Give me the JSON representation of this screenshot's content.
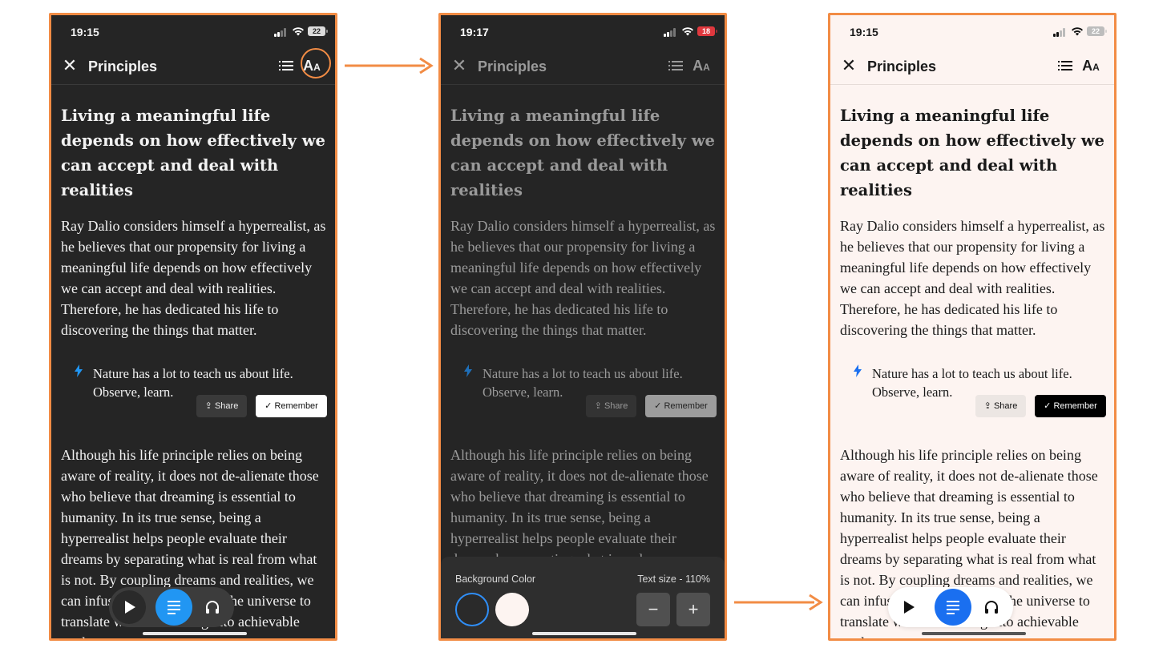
{
  "colors": {
    "outline": "#f28c45",
    "dark_bg": "#252525",
    "light_bg": "#fdf4f1",
    "accent_dark_mode": "#2196f3",
    "accent_light_mode": "#1a6ff0"
  },
  "screens": [
    {
      "time": "19:15",
      "battery": "22",
      "title": "Principles",
      "close_icon": "close-icon",
      "toc_icon": "list-icon",
      "font_icon_label": "AA",
      "heading": "Living a meaningful life depends on how effectively we can accept and deal with realities",
      "paragraph1": "Ray Dalio considers himself a hyperrealist, as he believes that our propensity for living a meaningful life depends on how effectively we can accept and deal with realities. Therefore, he has dedicated his life to discovering the things that matter.",
      "insight": "Nature has a lot to teach us about life. Observe, learn.",
      "share_label": "Share",
      "remember_label": "Remember",
      "paragraph2": "Although his life principle relies on being aware of reality, it does not de-alienate those who believe that dreaming is essential to humanity. In its true sense, being a hyperrealist helps people evaluate their dreams by separating what is real from what is not. By coupling dreams and realities, we can infuse the many laws of the universe to translate wishful thinking into achievable goals."
    },
    {
      "time": "19:17",
      "battery": "18",
      "title": "Principles",
      "heading": "Living a meaningful life depends on how effectively we can accept and deal with realities",
      "paragraph1": "Ray Dalio considers himself a hyperrealist, as he believes that our propensity for living a meaningful life depends on how effectively we can accept and deal with realities. Therefore, he has dedicated his life to discovering the things that matter.",
      "insight": "Nature has a lot to teach us about life. Observe, learn.",
      "share_label": "Share",
      "remember_label": "Remember",
      "paragraph2": "Although his life principle relies on being aware of reality, it does not de-alienate those who believe that dreaming is essential to humanity. In its true sense, being a hyperrealist helps people evaluate their dreams by separating what is real",
      "sheet": {
        "background_label": "Background Color",
        "text_size_label": "Text size - 110%",
        "minus": "−",
        "plus": "+"
      }
    },
    {
      "time": "19:15",
      "battery": "22",
      "title": "Principles",
      "heading": "Living a meaningful life depends on how effectively we can accept and deal with realities",
      "paragraph1": "Ray Dalio considers himself a hyperrealist, as he believes that our propensity for living a meaningful life depends on how effectively we can accept and deal with realities. Therefore, he has dedicated his life to discovering the things that matter.",
      "insight": "Nature has a lot to teach us about life. Observe, learn.",
      "share_label": "Share",
      "remember_label": "Remember",
      "paragraph2": "Although his life principle relies on being aware of reality, it does not de-alienate those who believe that dreaming is essential to humanity. In its true sense, being a hyperrealist helps people evaluate their dreams by separating what is real from what is not. By coupling dreams and realities, we can infuse the many laws of the universe to translate wishful thinking into achievable goals."
    }
  ]
}
